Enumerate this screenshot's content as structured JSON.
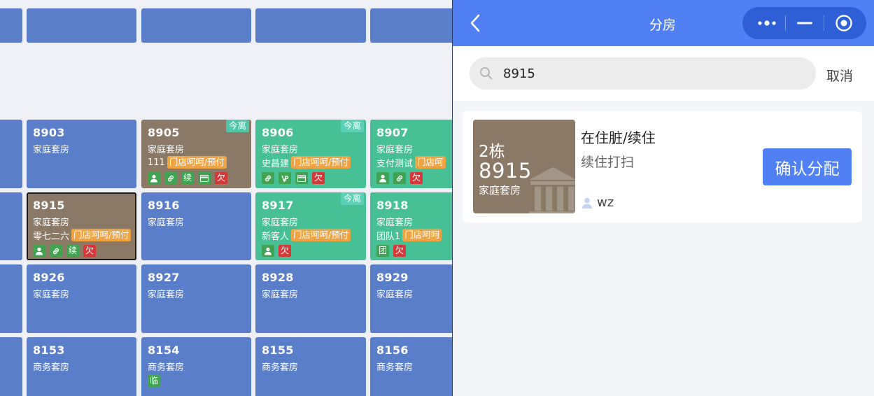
{
  "colors": {
    "vacant_tile": "#5a7ec9",
    "occupied_dirty_tile": "#8b7966",
    "occupied_tile": "#47c096",
    "order_tag": "#f0a341",
    "icon_green": "#3fa352",
    "icon_red": "#d6383a",
    "header_blue": "#5080f4",
    "capsule": "#2f5fd6"
  },
  "rooms": {
    "r8903": {
      "number": "8903",
      "type": "家庭套房"
    },
    "r8905": {
      "number": "8905",
      "type": "家庭套房",
      "badge": "今离",
      "guest": "111",
      "tag": "门店呵呵/预付",
      "icons": [
        "guest-icon",
        "link-icon",
        "续",
        "card-icon",
        "欠"
      ]
    },
    "r8906": {
      "number": "8906",
      "type": "家庭套房",
      "badge": "今离",
      "guest": "史昌建",
      "tag": "门店呵呵/预付",
      "icons": [
        "link-icon",
        "vip-icon",
        "card-icon",
        "欠"
      ]
    },
    "r8907": {
      "number": "8907",
      "type": "家庭套房",
      "guest": "支付测试",
      "tag": "门店呵",
      "icons": [
        "guest-icon",
        "link-icon",
        "欠"
      ]
    },
    "r8915": {
      "number": "8915",
      "type": "家庭套房",
      "guest": "零七二六",
      "tag": "门店呵呵/预付",
      "icons": [
        "guest-icon",
        "link-icon",
        "续",
        "欠"
      ]
    },
    "r8916": {
      "number": "8916",
      "type": "家庭套房"
    },
    "r8917": {
      "number": "8917",
      "type": "家庭套房",
      "badge": "今离",
      "guest": "新客人",
      "tag": "门店呵呵/预付",
      "icons": [
        "guest-icon",
        "欠"
      ]
    },
    "r8918": {
      "number": "8918",
      "type": "家庭套房",
      "guest": "团队1",
      "tag": "门店呵呵",
      "icons": [
        "团",
        "欠"
      ]
    },
    "r8926": {
      "number": "8926",
      "type": "家庭套房"
    },
    "r8927": {
      "number": "8927",
      "type": "家庭套房"
    },
    "r8928": {
      "number": "8928",
      "type": "家庭套房"
    },
    "r8929": {
      "number": "8929",
      "type": "家庭套房"
    },
    "r8153": {
      "number": "8153",
      "type": "商务套房"
    },
    "r8154": {
      "number": "8154",
      "type": "商务套房",
      "icons": [
        "临"
      ]
    },
    "r8155": {
      "number": "8155",
      "type": "商务套房"
    },
    "r8156": {
      "number": "8156",
      "type": "商务套房"
    }
  },
  "panel": {
    "title": "分房",
    "search": {
      "value": "8915"
    },
    "cancel_label": "取消",
    "result": {
      "building": "2栋",
      "room_number": "8915",
      "room_type": "家庭套房",
      "status": "在住脏/续住",
      "clean_status": "续住打扫",
      "operator": "wz",
      "confirm_label": "确认分配"
    }
  }
}
